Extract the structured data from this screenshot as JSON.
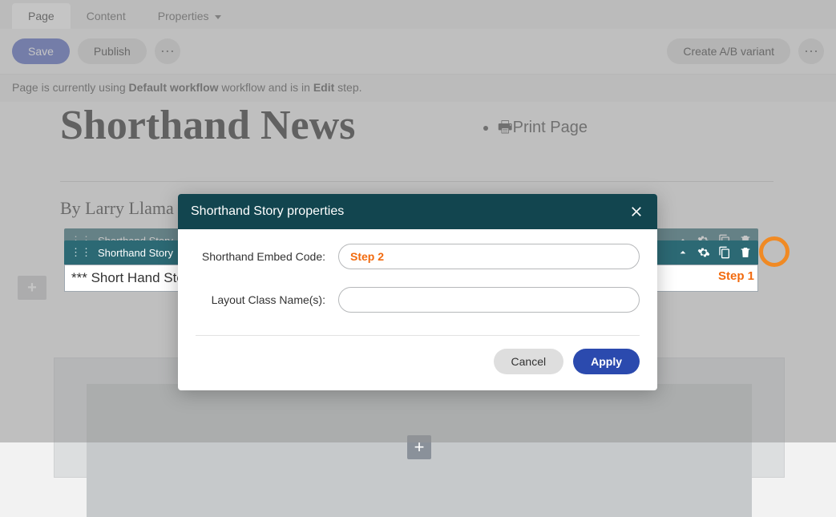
{
  "tabs": {
    "page": "Page",
    "content": "Content",
    "properties": "Properties"
  },
  "toolbar": {
    "save": "Save",
    "publish": "Publish",
    "create_variant": "Create A/B variant"
  },
  "workflow_status": {
    "prefix": "Page is currently using ",
    "workflow_name": "Default workflow",
    "mid": " workflow and is in ",
    "step": "Edit",
    "suffix": " step."
  },
  "main": {
    "title": "Shorthand News",
    "print_link": "🖶Print Page",
    "byline": "By Larry Llama"
  },
  "story": {
    "bar_title": "Shorthand Story",
    "body": "*** Short Hand Story",
    "step1_annot": "Step 1"
  },
  "modal": {
    "title": "Shorthand Story properties",
    "field1_label": "Shorthand Embed Code:",
    "field1_value": "Step 2",
    "field2_label": "Layout Class Name(s):",
    "field2_value": "",
    "cancel": "Cancel",
    "apply": "Apply"
  }
}
